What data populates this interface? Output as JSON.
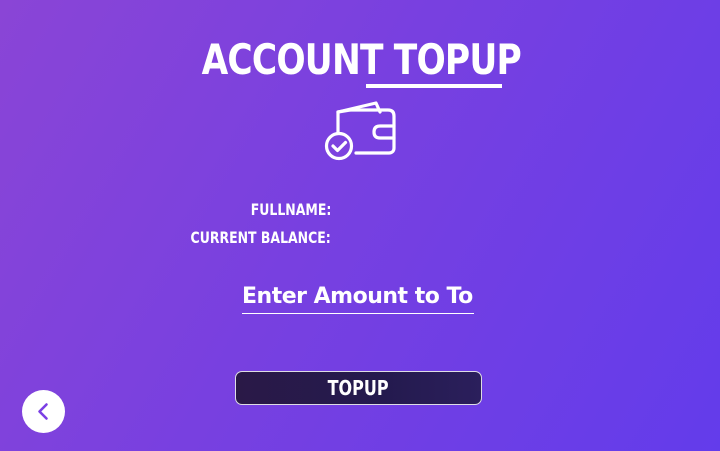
{
  "header": {
    "title": "ACCOUNT TOPUP"
  },
  "icons": {
    "wallet": "wallet-check-icon",
    "back": "chevron-left-icon"
  },
  "account_info": {
    "fullname_label": "FULLNAME:",
    "fullname_value": "",
    "balance_label": "CURRENT BALANCE:",
    "balance_value": ""
  },
  "amount_input": {
    "placeholder": "Enter Amount to Topup",
    "value": ""
  },
  "topup_button": {
    "label": "TOPUP"
  },
  "colors": {
    "background_start": "#8a45d6",
    "background_end": "#633ceb",
    "button_background": "#241a4e",
    "back_icon": "#7b3fe4"
  }
}
